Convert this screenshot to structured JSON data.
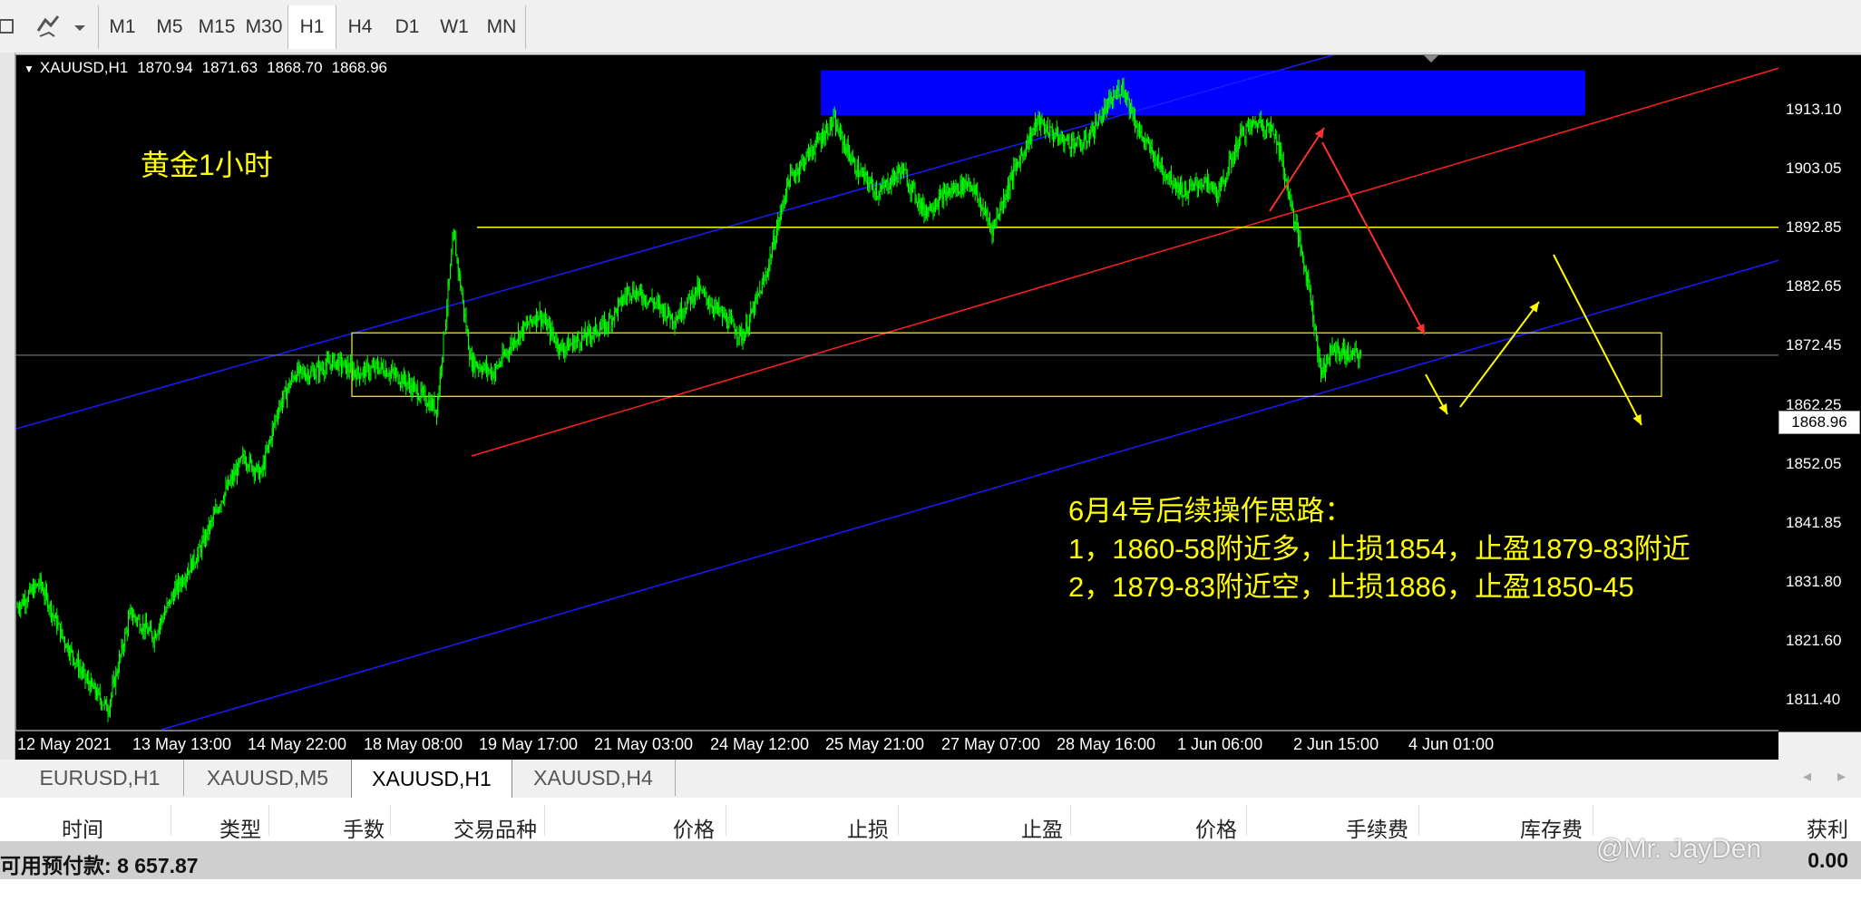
{
  "toolbar": {
    "timeframes": [
      "M1",
      "M5",
      "M15",
      "M30",
      "H1",
      "H4",
      "D1",
      "W1",
      "MN"
    ],
    "active_timeframe": "H1"
  },
  "chart": {
    "symbol_info": "XAUUSD,H1",
    "ohlc": {
      "open": "1870.94",
      "high": "1871.63",
      "low": "1868.70",
      "close": "1868.96"
    },
    "title": "黄金1小时",
    "note_lines": [
      "6月4号后续操作思路：",
      "1，1860-58附近多，止损1854，止盈1879-83附近",
      "2，1879-83附近空，止损1886，止盈1850-45"
    ],
    "price_labels": [
      "1913.10",
      "1903.05",
      "1892.85",
      "1882.65",
      "1872.45",
      "1862.25",
      "1852.05",
      "1841.85",
      "1831.80",
      "1821.60",
      "1811.40"
    ],
    "current_price": "1868.96",
    "time_labels": [
      "12 May 2021",
      "13 May 13:00",
      "14 May 22:00",
      "18 May 08:00",
      "19 May 17:00",
      "21 May 03:00",
      "24 May 12:00",
      "25 May 21:00",
      "27 May 07:00",
      "28 May 16:00",
      "1 Jun 06:00",
      "2 Jun 15:00",
      "4 Jun 01:00"
    ],
    "colors": {
      "background": "#000000",
      "candles": "#00ff00",
      "channel": "#1a1aff",
      "trendline": "#ff2020",
      "level": "#ffff00",
      "zone": "#0000ff",
      "text": "#ffff00"
    }
  },
  "chart_data": {
    "type": "candlestick",
    "title": "黄金1小时",
    "ylim": [
      1806.5,
      1919.0
    ],
    "y_ticks": [
      1913.1,
      1903.05,
      1892.85,
      1882.65,
      1872.45,
      1862.25,
      1852.05,
      1841.85,
      1831.8,
      1821.6,
      1811.4
    ],
    "x_ticks": [
      "12 May 2021",
      "13 May 13:00",
      "14 May 22:00",
      "18 May 08:00",
      "19 May 17:00",
      "21 May 03:00",
      "24 May 12:00",
      "25 May 21:00",
      "27 May 07:00",
      "28 May 16:00",
      "1 Jun 06:00",
      "2 Jun 15:00",
      "4 Jun 01:00"
    ],
    "close_path": [
      [
        0,
        1827
      ],
      [
        20,
        1831
      ],
      [
        40,
        1822
      ],
      [
        60,
        1815
      ],
      [
        80,
        1810
      ],
      [
        100,
        1826
      ],
      [
        120,
        1822
      ],
      [
        140,
        1830
      ],
      [
        160,
        1836
      ],
      [
        180,
        1845
      ],
      [
        200,
        1852
      ],
      [
        215,
        1849
      ],
      [
        230,
        1860
      ],
      [
        245,
        1866
      ],
      [
        260,
        1866
      ],
      [
        280,
        1868
      ],
      [
        300,
        1866
      ],
      [
        320,
        1867
      ],
      [
        340,
        1865
      ],
      [
        370,
        1860
      ],
      [
        385,
        1889
      ],
      [
        400,
        1868
      ],
      [
        420,
        1866
      ],
      [
        440,
        1872
      ],
      [
        460,
        1876
      ],
      [
        480,
        1870
      ],
      [
        500,
        1872
      ],
      [
        520,
        1874
      ],
      [
        540,
        1880
      ],
      [
        560,
        1878
      ],
      [
        580,
        1875
      ],
      [
        600,
        1880
      ],
      [
        620,
        1876
      ],
      [
        640,
        1872
      ],
      [
        660,
        1882
      ],
      [
        680,
        1898
      ],
      [
        700,
        1903
      ],
      [
        720,
        1908
      ],
      [
        740,
        1900
      ],
      [
        760,
        1896
      ],
      [
        780,
        1900
      ],
      [
        800,
        1893
      ],
      [
        820,
        1896
      ],
      [
        840,
        1898
      ],
      [
        860,
        1890
      ],
      [
        880,
        1900
      ],
      [
        900,
        1908
      ],
      [
        920,
        1905
      ],
      [
        940,
        1904
      ],
      [
        960,
        1910
      ],
      [
        975,
        1914
      ],
      [
        990,
        1906
      ],
      [
        1010,
        1900
      ],
      [
        1030,
        1896
      ],
      [
        1045,
        1898
      ],
      [
        1060,
        1896
      ],
      [
        1080,
        1906
      ],
      [
        1095,
        1908
      ],
      [
        1110,
        1906
      ],
      [
        1125,
        1893
      ],
      [
        1140,
        1880
      ],
      [
        1150,
        1866
      ],
      [
        1160,
        1870
      ],
      [
        1175,
        1869
      ],
      [
        1185,
        1868.96
      ]
    ],
    "current_price": 1868.96,
    "levels": {
      "resistance_zone": [
        1909.0,
        1916.5
      ],
      "horizontal_line": 1890.3,
      "range_box": [
        1862.1,
        1872.7
      ]
    },
    "annotations": [
      "6月4号后续操作思路：",
      "1，1860-58附近多，止损1854，止盈1879-83附近",
      "2，1879-83附近空，止损1886，止盈1850-45"
    ]
  },
  "tabs": {
    "items": [
      "EURUSD,H1",
      "XAUUSD,M5",
      "XAUUSD,H1",
      "XAUUSD,H4"
    ],
    "active": "XAUUSD,H1",
    "nav": {
      "left": "◂",
      "right": "▸"
    }
  },
  "terminal": {
    "columns": [
      "时间",
      "类型",
      "手数",
      "交易品种",
      "价格",
      "止损",
      "止盈",
      "价格",
      "手续费",
      "库存费",
      "获利"
    ],
    "balance_label": "可用预付款:",
    "balance_value": "8 657.87",
    "profit_total": "0.00",
    "watermark": "@Mr. JayDen"
  }
}
